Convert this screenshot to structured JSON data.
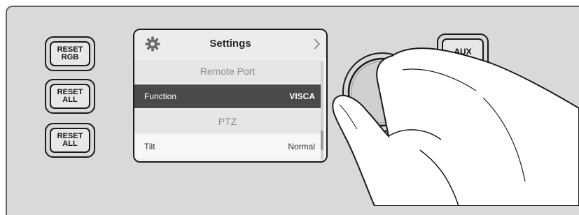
{
  "buttons": {
    "reset_rgb": "RESET\nRGB",
    "reset_all_1": "RESET\nALL",
    "reset_all_2": "RESET\nALL",
    "aux": "AUX"
  },
  "lcd": {
    "title": "Settings",
    "gear_icon": "gear-icon",
    "chevron_icon": "chevron-right-icon",
    "rows": [
      {
        "type": "section",
        "label": "Remote Port"
      },
      {
        "type": "selected",
        "label": "Function",
        "value": "VISCA"
      },
      {
        "type": "section",
        "label": "PTZ"
      },
      {
        "type": "item",
        "label": "Tilt",
        "value": "Normal"
      }
    ]
  },
  "colors": {
    "panel": "#d9d9d9",
    "outline": "#1a1a1a",
    "selected_row": "#4a4a4a"
  }
}
